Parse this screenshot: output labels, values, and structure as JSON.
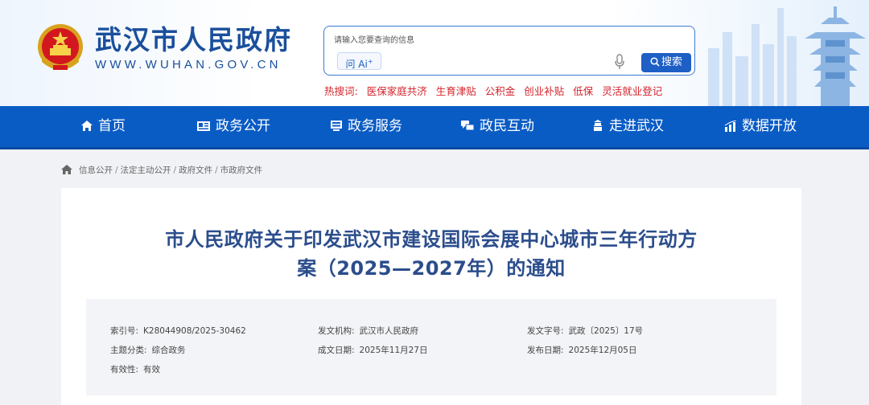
{
  "header": {
    "site_name": "武汉市人民政府",
    "site_url": "WWW.WUHAN.GOV.CN",
    "search_placeholder": "请输入您要查询的信息",
    "ai_label": "问 Ai",
    "ai_sup": "+",
    "search_button": "搜索",
    "hot_label": "热搜词:",
    "hot_items": [
      "医保家庭共济",
      "生育津贴",
      "公积金",
      "创业补贴",
      "低保",
      "灵活就业登记"
    ]
  },
  "nav": {
    "items": [
      {
        "label": "首页",
        "icon": "home-icon"
      },
      {
        "label": "政务公开",
        "icon": "newspaper-icon"
      },
      {
        "label": "政务服务",
        "icon": "service-icon"
      },
      {
        "label": "政民互动",
        "icon": "interaction-icon"
      },
      {
        "label": "走进武汉",
        "icon": "building-icon"
      },
      {
        "label": "数据开放",
        "icon": "chart-icon"
      }
    ]
  },
  "breadcrumb": {
    "items": [
      "信息公开",
      "法定主动公开",
      "政府文件",
      "市政府文件"
    ],
    "separator": "/"
  },
  "document": {
    "title_line1": "市人民政府关于印发武汉市建设国际会展中心城市三年行动方",
    "title_line2": "案（2025—2027年）的通知",
    "meta": {
      "index_key": "索引号:",
      "index_val": "K28044908/2025-30462",
      "issuer_key": "发文机构:",
      "issuer_val": "武汉市人民政府",
      "docno_key": "发文字号:",
      "docno_val": "武政〔2025〕17号",
      "topic_key": "主题分类:",
      "topic_val": "综合政务",
      "created_key": "成文日期:",
      "created_val": "2025年11月27日",
      "published_key": "发布日期:",
      "published_val": "2025年12月05日",
      "validity_key": "有效性:",
      "validity_val": "有效"
    }
  },
  "colors": {
    "brand_blue": "#1a4f9c",
    "nav_blue": "#0a5cc5",
    "hot_red": "#d4232b",
    "title_blue": "#2b4d8c"
  }
}
